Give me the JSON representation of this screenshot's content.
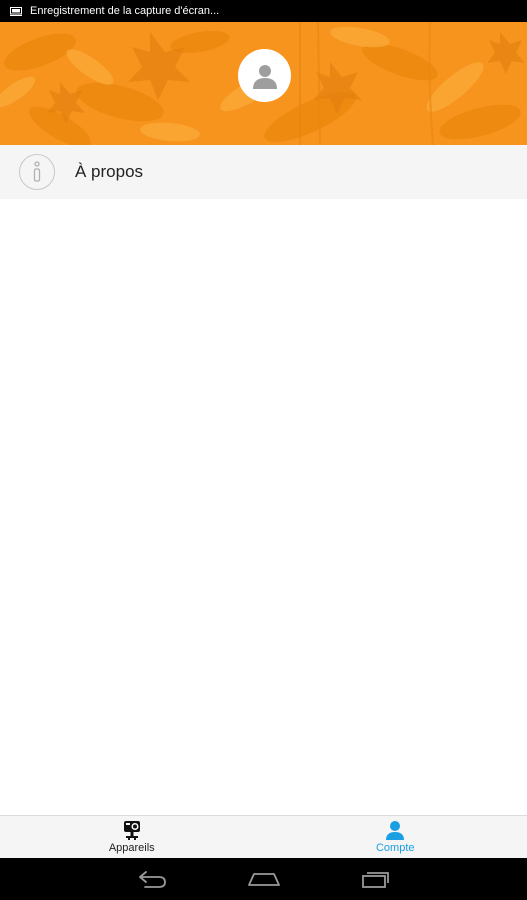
{
  "status_bar": {
    "notification_text": "Enregistrement de la capture d'écran..."
  },
  "header": {
    "avatar_icon": "person-icon",
    "banner_color": "#f7941d"
  },
  "menu": {
    "items": [
      {
        "label": "À propos",
        "icon": "info-icon"
      }
    ]
  },
  "tabs": [
    {
      "label": "Appareils",
      "icon": "camera-device-icon",
      "active": false
    },
    {
      "label": "Compte",
      "icon": "person-icon",
      "active": true
    }
  ],
  "colors": {
    "accent": "#1a9fe3",
    "banner": "#f7941d"
  }
}
